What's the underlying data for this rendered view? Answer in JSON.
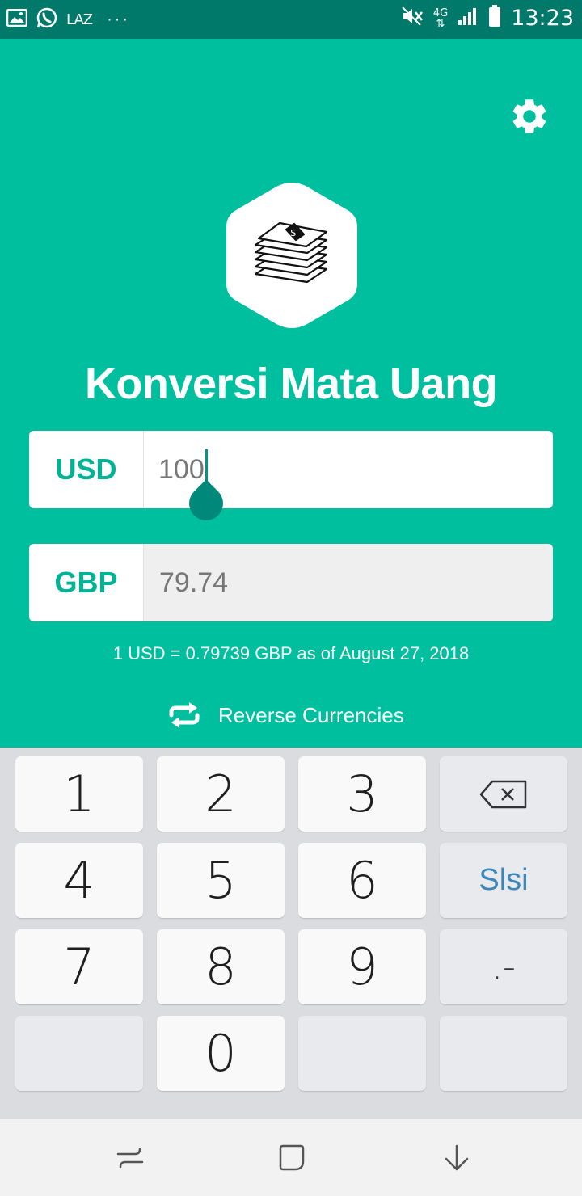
{
  "status_bar": {
    "carrier_text": "LAZ",
    "more_dots": "···",
    "network_type": "4G",
    "time": "13:23"
  },
  "app": {
    "title": "Konversi Mata Uang",
    "from_currency": "USD",
    "from_value": "100",
    "to_currency": "GBP",
    "to_value": "79.74",
    "rate_text": "1 USD = 0.79739 GBP as of August 27, 2018",
    "reverse_label": "Reverse Currencies"
  },
  "keypad": {
    "k1": "1",
    "k2": "2",
    "k3": "3",
    "k4": "4",
    "k5": "5",
    "k6": "6",
    "k7": "7",
    "k8": "8",
    "k9": "9",
    "k0": "0",
    "done_label": "Slsi",
    "dot_dash": ".-"
  },
  "icons": {
    "settings": "gear-icon",
    "logo": "money-stack-icon",
    "reverse": "swap-arrows-icon",
    "backspace": "backspace-icon"
  },
  "colors": {
    "primary": "#00bf9e",
    "status_bar": "#00796b",
    "accent_text": "#00b394"
  }
}
